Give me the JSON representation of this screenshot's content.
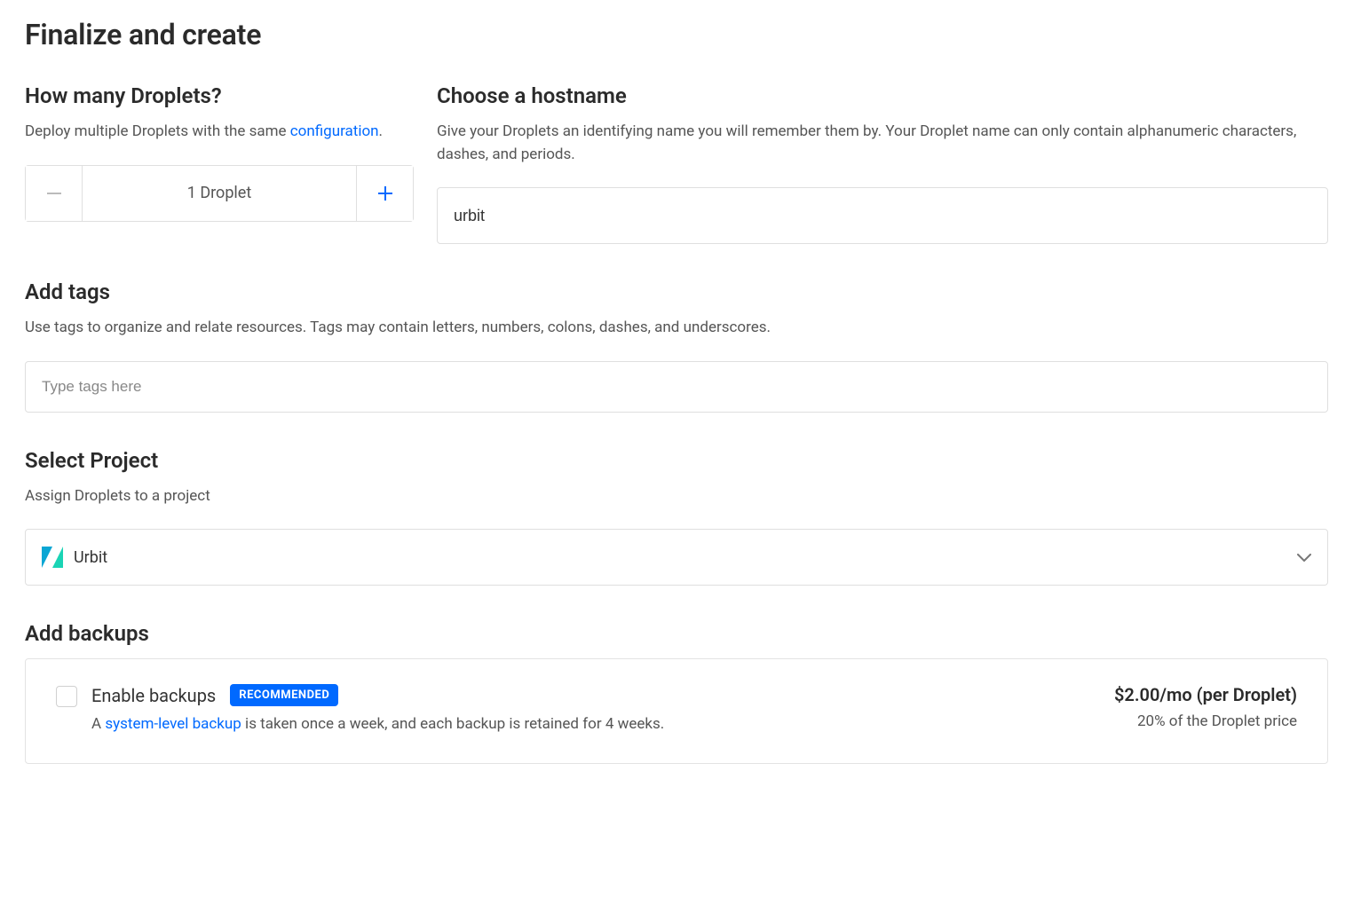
{
  "page": {
    "title": "Finalize and create"
  },
  "droplets": {
    "heading": "How many Droplets?",
    "desc_prefix": "Deploy multiple Droplets with the same ",
    "desc_link": "configuration",
    "desc_suffix": ".",
    "count_label": "1 Droplet"
  },
  "hostname": {
    "heading": "Choose a hostname",
    "desc": "Give your Droplets an identifying name you will remember them by. Your Droplet name can only contain alphanumeric characters, dashes, and periods.",
    "value": "urbit"
  },
  "tags": {
    "heading": "Add tags",
    "desc": "Use tags to organize and relate resources. Tags may contain letters, numbers, colons, dashes, and underscores.",
    "placeholder": "Type tags here"
  },
  "project": {
    "heading": "Select Project",
    "desc": "Assign Droplets to a project",
    "selected": "Urbit"
  },
  "backups": {
    "heading": "Add backups",
    "enable_label": "Enable backups",
    "badge": "RECOMMENDED",
    "desc_prefix": "A ",
    "desc_link": "system-level backup",
    "desc_suffix": " is taken once a week, and each backup is retained for 4 weeks.",
    "price": "$2.00/mo (per Droplet)",
    "pct": "20% of the Droplet price"
  }
}
